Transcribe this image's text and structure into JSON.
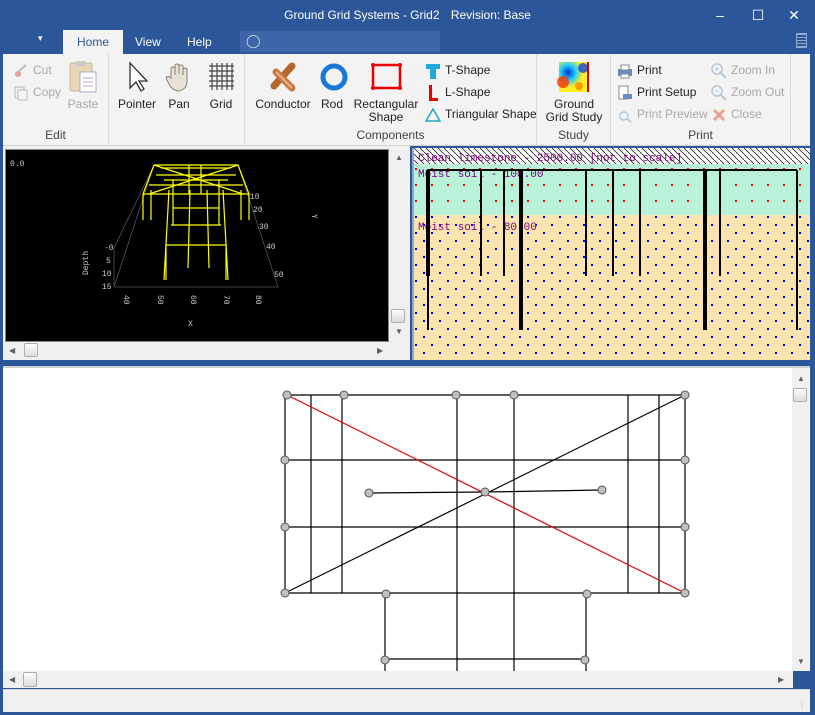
{
  "window": {
    "app_title": "Ground Grid Systems - Grid2",
    "revision": "Revision: Base",
    "minimize": "–",
    "maximize": "☐",
    "close": "✕"
  },
  "tabs": [
    {
      "label": "Home",
      "active": true
    },
    {
      "label": "View",
      "active": false
    },
    {
      "label": "Help",
      "active": false
    }
  ],
  "quick_access": "▾",
  "ribbon": {
    "edit": {
      "label": "Edit",
      "cut": "Cut",
      "copy": "Copy",
      "paste": "Paste"
    },
    "tools": {
      "pointer": "Pointer",
      "pan": "Pan",
      "grid": "Grid"
    },
    "components": {
      "label": "Components",
      "conductor": "Conductor",
      "rod": "Rod",
      "rectangular_line1": "Rectangular",
      "rectangular_line2": "Shape",
      "t_shape": "T-Shape",
      "l_shape": "L-Shape",
      "triangular": "Triangular Shape"
    },
    "study": {
      "label": "Study",
      "ground_line1": "Ground",
      "ground_line2": "Grid Study"
    },
    "print": {
      "label": "Print",
      "print": "Print",
      "print_setup": "Print Setup",
      "print_preview": "Print Preview",
      "zoom_in": "Zoom In",
      "zoom_out": "Zoom Out",
      "close": "Close"
    }
  },
  "view3d": {
    "corner_value": "0.0",
    "depth_label": "Depth",
    "x_label": "X",
    "y_label": "Y",
    "depth_ticks": [
      "-0",
      "5",
      "10",
      "15"
    ],
    "x_ticks": [
      "40",
      "50",
      "60",
      "70",
      "80"
    ],
    "y_ticks": [
      "10",
      "20",
      "30",
      "40",
      "50"
    ]
  },
  "soil": {
    "top_layer": "Clean limestone - 2500.00    [not to scale]",
    "layer1": "Moist soil - 100.00",
    "layer2": "Moist soil - 80.00",
    "colors": {
      "layer1": "#b9f2d8",
      "layer2": "#fce4b0",
      "label": "#800080"
    }
  },
  "colors": {
    "accent": "#2b579a",
    "red_line": "#e00000",
    "node": "#c0c0c0"
  }
}
